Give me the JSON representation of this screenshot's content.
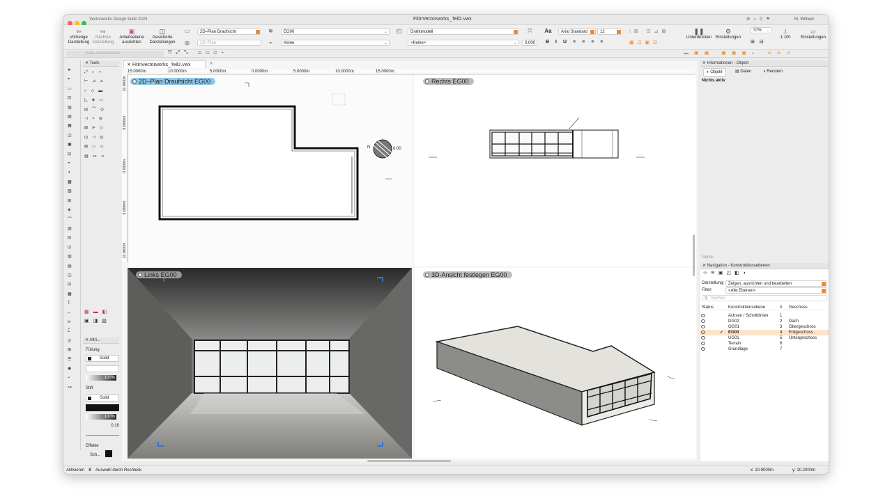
{
  "window": {
    "app_title": "Vectorworks Design Suite 2024",
    "doc_title": "FitinVectorworks_Teil2.vwx",
    "user": "M. Wittwer"
  },
  "toolbar": {
    "vorherige": "Vorherige Darstellung",
    "naechste": "Nächste Darstellung",
    "arbeitsebene": "Arbeitsebene ausrichten",
    "gesicherte": "Gesicherte Darstellungen",
    "view_select": "2D–Plan Draufsicht",
    "view_select2": "2D–Plan",
    "layer_select": "EG00",
    "class_select": "Keine",
    "render_select": "Drahtmodell",
    "keine_select": "<Keine>",
    "offset": "0.000",
    "font": "Arial Standard",
    "font_size": "12",
    "unterdruecken": "Unterdrücken",
    "einstellungen": "Einstellungen",
    "zoom": "37%",
    "scale": "1:100",
    "einstellungen2": "Einstellungen",
    "auto_arbeitsebene": "Auto-Arbeitsebene"
  },
  "tab": {
    "name": "FitinVectorworks_Teil2.vwx",
    "add": "+"
  },
  "ruler": {
    "h_ticks": [
      "15.0000m",
      "10.0000m",
      "5.0000m",
      "0.0000m",
      "5.0000m",
      "10.0000m",
      "15.0000m"
    ],
    "v_ticks": [
      "10.0000m",
      "5.0000m",
      "0.0000m",
      "5.0000m",
      "10.0000m"
    ]
  },
  "viewports": {
    "top_left": "2D–Plan Draufsicht  EG00",
    "top_right": "Rechts  EG00",
    "bottom_left": "Links  EG00",
    "bottom_right": "3D-Ansicht festlegen  EG00"
  },
  "tools_panel": {
    "title": "Tools"
  },
  "attr_panel": {
    "title": "Attri...",
    "fuellung": "Füllung",
    "solid": "Solid",
    "pct1": "100%",
    "stift": "Stift",
    "solid2": "Solid",
    "pct2": "100%",
    "line_w": "0.10",
    "effekte": "Effekte",
    "sch": "Sch..."
  },
  "info_panel": {
    "title": "Informationen - Objekt",
    "tabs": [
      "Objekt",
      "Daten",
      "Rendern"
    ],
    "status": "Nichts aktiv",
    "name_label": "Name:"
  },
  "nav_panel": {
    "title": "Navigation - Konstruktionsebenen",
    "darstellung_label": "Darstellung:",
    "darstellung_value": "Zeigen, ausrichten und bearbeiten",
    "filter_label": "Filter:",
    "filter_value": "<Alle Ebenen>",
    "search_placeholder": "Suchen",
    "columns": [
      "Status",
      "Konstruktionsebene",
      "#",
      "Geschoss"
    ],
    "rows": [
      {
        "name": "Achsen / Schnittlinien",
        "num": "1",
        "floor": ""
      },
      {
        "name": "DG02",
        "num": "2",
        "floor": "Dach"
      },
      {
        "name": "OG01",
        "num": "3",
        "floor": "Obergeschoss"
      },
      {
        "name": "EG00",
        "num": "4",
        "floor": "Erdgeschoss",
        "active": true
      },
      {
        "name": "UG01",
        "num": "5",
        "floor": "Untergeschoss"
      },
      {
        "name": "Terrain",
        "num": "6",
        "floor": ""
      },
      {
        "name": "Grundlage",
        "num": "7",
        "floor": ""
      }
    ]
  },
  "statusbar": {
    "mode": "Aktivieren",
    "hint": "Auswahl durch Rechteck",
    "x": "x: 10.9000m",
    "y": "y: 10.2000m"
  },
  "compass": {
    "n": "N",
    "text": "0:00"
  },
  "colors": {
    "accent": "#f08a2c",
    "label_blue": "#8fc7e8",
    "label_gray": "#b9b9b9",
    "active_row": "#fde3c9"
  }
}
